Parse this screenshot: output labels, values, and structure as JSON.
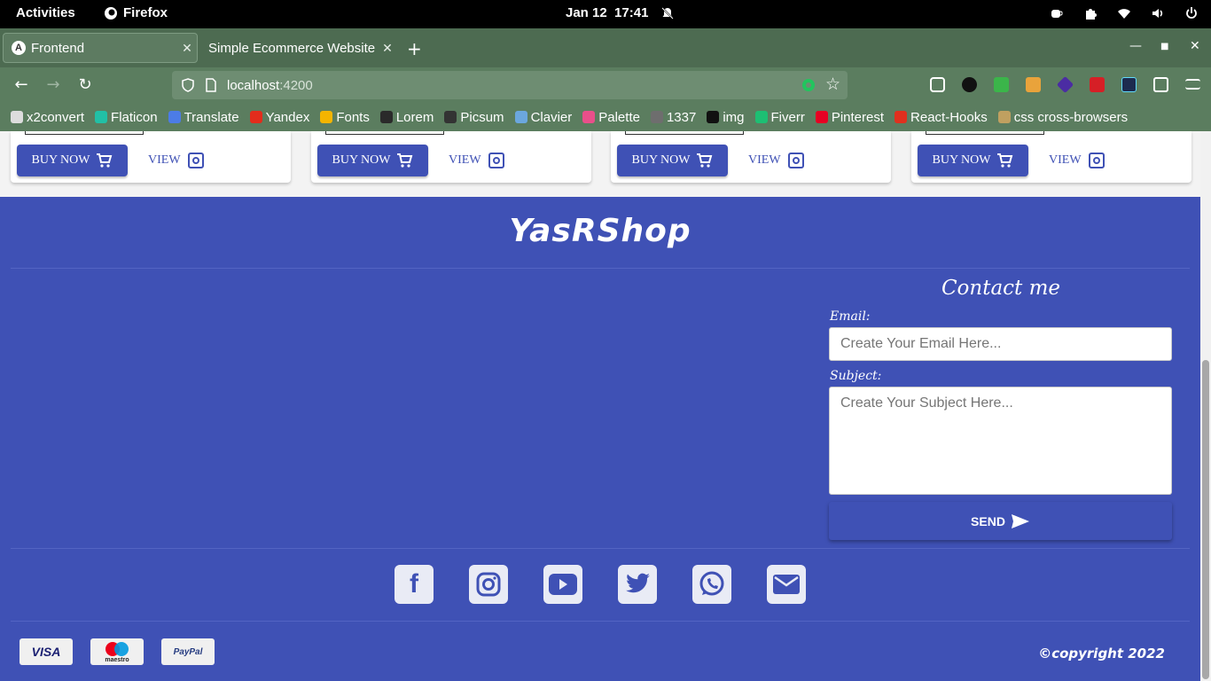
{
  "system_bar": {
    "activities": "Activities",
    "app_name": "Firefox",
    "date": "Jan 12",
    "time": "17:41"
  },
  "browser": {
    "tabs": [
      {
        "label": "Frontend",
        "active": true
      },
      {
        "label": "Simple Ecommerce Website",
        "active": false
      }
    ],
    "url_host": "localhost",
    "url_port": ":4200",
    "bookmarks": [
      {
        "label": "x2convert",
        "color": "#dddddd"
      },
      {
        "label": "Flaticon",
        "color": "#21c0a6"
      },
      {
        "label": "Translate",
        "color": "#4c7ce6"
      },
      {
        "label": "Yandex",
        "color": "#e32c1c"
      },
      {
        "label": "Fonts",
        "color": "#f4b400"
      },
      {
        "label": "Lorem",
        "color": "#2a2a2a"
      },
      {
        "label": "Picsum",
        "color": "#333333"
      },
      {
        "label": "Clavier",
        "color": "#6ba7de"
      },
      {
        "label": "Palette",
        "color": "#e94f8a"
      },
      {
        "label": "1337",
        "color": "#6e6e6e"
      },
      {
        "label": "img",
        "color": "#111111"
      },
      {
        "label": "Fiverr",
        "color": "#1dbf73"
      },
      {
        "label": "Pinterest",
        "color": "#e60023"
      },
      {
        "label": "React-Hooks",
        "color": "#e0301e"
      },
      {
        "label": "css cross-browsers",
        "color": "#c0a060"
      }
    ]
  },
  "products": [
    {
      "buy_label": "BUY NOW",
      "view_label": "VIEW"
    },
    {
      "buy_label": "BUY NOW",
      "view_label": "VIEW"
    },
    {
      "buy_label": "BUY NOW",
      "view_label": "VIEW"
    },
    {
      "buy_label": "BUY NOW",
      "view_label": "VIEW"
    }
  ],
  "footer": {
    "brand": "YasRShop",
    "contact_title": "Contact me",
    "email_label": "Email:",
    "email_placeholder": "Create Your Email Here...",
    "subject_label": "Subject:",
    "subject_placeholder": "Create Your Subject Here...",
    "send_label": "SEND",
    "socials": [
      "facebook-icon",
      "instagram-icon",
      "youtube-icon",
      "twitter-icon",
      "whatsapp-icon",
      "mail-icon"
    ],
    "payments": [
      "VISA",
      "maestro",
      "PayPal"
    ],
    "copyright": "©copyright 2022"
  },
  "colors": {
    "primary": "#3f51b5",
    "browser_chrome": "#5b7d5f",
    "tab_strip": "#4d6b51"
  }
}
